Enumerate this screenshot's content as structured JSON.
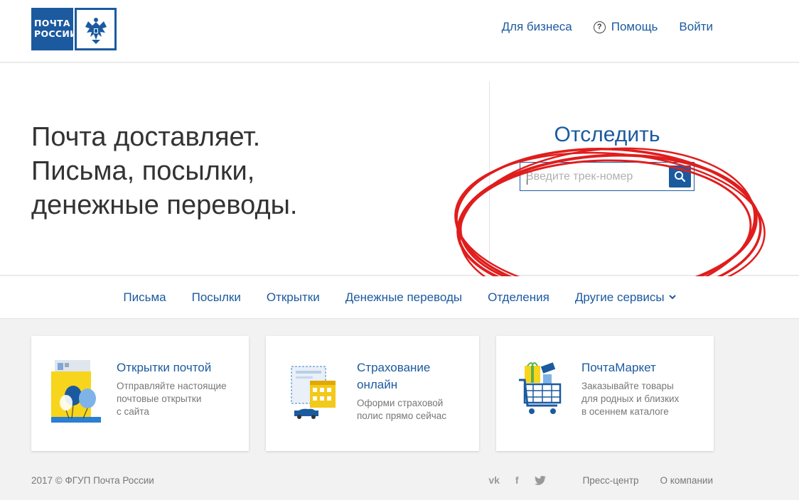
{
  "logo": {
    "line1": "ПОЧТА",
    "line2": "РОССИИ"
  },
  "header_nav": {
    "business": "Для бизнеса",
    "help": "Помощь",
    "help_icon": "?",
    "login": "Войти"
  },
  "hero": {
    "line1": "Почта доставляет.",
    "line2": "Письма, посылки,",
    "line3": "денежные переводы."
  },
  "tracking": {
    "title": "Отследить",
    "placeholder": "Введите трек-номер",
    "value": ""
  },
  "menu": {
    "items": [
      "Письма",
      "Посылки",
      "Открытки",
      "Денежные переводы",
      "Отделения",
      "Другие сервисы"
    ]
  },
  "cards": [
    {
      "title": "Открытки почтой",
      "desc1": "Отправляйте настоящие",
      "desc2": "почтовые открытки",
      "desc3": "с сайта",
      "icon": "postcard-icon"
    },
    {
      "title1": "Страхование",
      "title2": "онлайн",
      "desc1": "Оформи страховой",
      "desc2": "полис прямо сейчас",
      "icon": "insurance-icon"
    },
    {
      "title": "ПочтаМаркет",
      "desc1": "Заказывайте товары",
      "desc2": "для родных и близких",
      "desc3": "в осеннем каталоге",
      "icon": "shopping-cart-icon"
    }
  ],
  "footer": {
    "copyright": "2017 © ФГУП Почта России",
    "vk": "vk",
    "facebook": "f",
    "press": "Пресс-центр",
    "about": "О компании"
  },
  "colors": {
    "brand_blue": "#1b5a9f",
    "annotation_red": "#e01d1d"
  }
}
